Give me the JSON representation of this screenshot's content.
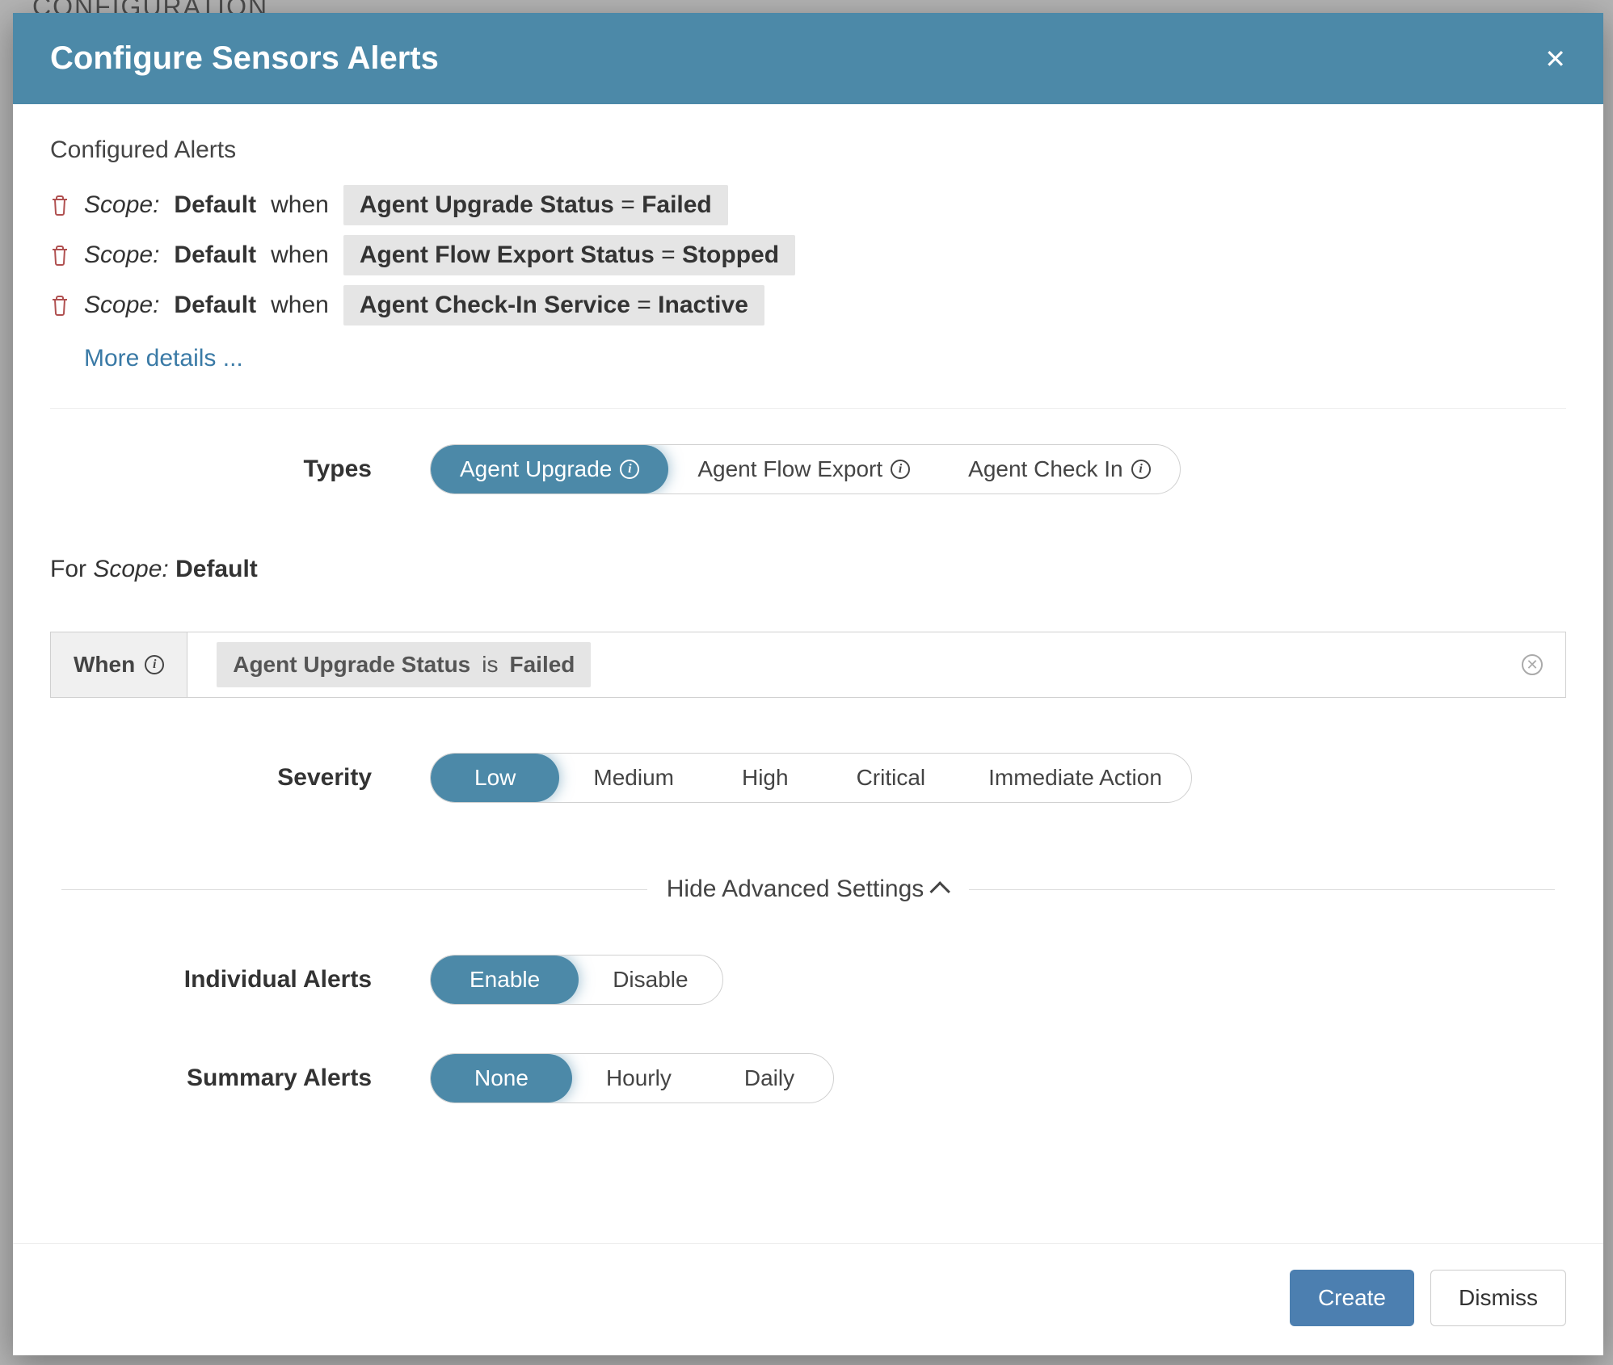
{
  "backdrop": {
    "title": "CONFIGURATION"
  },
  "modal": {
    "title": "Configure Sensors Alerts",
    "configured_heading": "Configured Alerts",
    "alerts": [
      {
        "scope_label": "Scope:",
        "scope_value": "Default",
        "when": "when",
        "metric": "Agent Upgrade Status",
        "op": "=",
        "value": "Failed"
      },
      {
        "scope_label": "Scope:",
        "scope_value": "Default",
        "when": "when",
        "metric": "Agent Flow Export Status",
        "op": "=",
        "value": "Stopped"
      },
      {
        "scope_label": "Scope:",
        "scope_value": "Default",
        "when": "when",
        "metric": "Agent Check-In Service",
        "op": "=",
        "value": "Inactive"
      }
    ],
    "more_details": "More details ...",
    "types_label": "Types",
    "types": [
      {
        "label": "Agent Upgrade",
        "selected": true
      },
      {
        "label": "Agent Flow Export",
        "selected": false
      },
      {
        "label": "Agent Check In",
        "selected": false
      }
    ],
    "for_scope": {
      "for": "For",
      "scope_word": "Scope:",
      "value": "Default"
    },
    "when_box": {
      "label": "When",
      "metric": "Agent Upgrade Status",
      "is": "is",
      "value": "Failed"
    },
    "severity_label": "Severity",
    "severities": [
      {
        "label": "Low",
        "selected": true
      },
      {
        "label": "Medium",
        "selected": false
      },
      {
        "label": "High",
        "selected": false
      },
      {
        "label": "Critical",
        "selected": false
      },
      {
        "label": "Immediate Action",
        "selected": false
      }
    ],
    "advanced_toggle": "Hide Advanced Settings",
    "individual_label": "Individual Alerts",
    "individual_options": [
      {
        "label": "Enable",
        "selected": true
      },
      {
        "label": "Disable",
        "selected": false
      }
    ],
    "summary_label": "Summary Alerts",
    "summary_options": [
      {
        "label": "None",
        "selected": true
      },
      {
        "label": "Hourly",
        "selected": false
      },
      {
        "label": "Daily",
        "selected": false
      }
    ],
    "footer": {
      "create": "Create",
      "dismiss": "Dismiss"
    }
  }
}
